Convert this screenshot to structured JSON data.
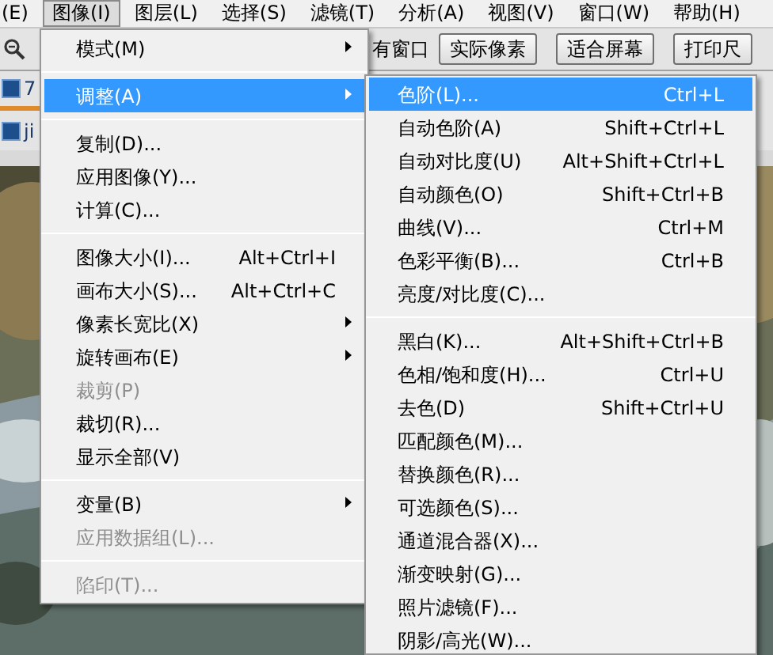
{
  "menubar": [
    {
      "label": "(E)",
      "selected": false
    },
    {
      "label": "图像(I)",
      "selected": true
    },
    {
      "label": "图层(L)",
      "selected": false
    },
    {
      "label": "选择(S)",
      "selected": false
    },
    {
      "label": "滤镜(T)",
      "selected": false
    },
    {
      "label": "分析(A)",
      "selected": false
    },
    {
      "label": "视图(V)",
      "selected": false
    },
    {
      "label": "窗口(W)",
      "selected": false
    },
    {
      "label": "帮助(H)",
      "selected": false
    }
  ],
  "toolbar": {
    "partial_label": "有窗口",
    "buttons": [
      "实际像素",
      "适合屏幕",
      "打印尺"
    ]
  },
  "documents": [
    {
      "label": "7"
    },
    {
      "label": "ji"
    }
  ],
  "image_menu": [
    {
      "kind": "item",
      "label": "模式(M)",
      "submenu": true,
      "selected": false,
      "disabled": false
    },
    {
      "kind": "separator"
    },
    {
      "kind": "item",
      "label": "调整(A)",
      "submenu": true,
      "selected": true,
      "disabled": false
    },
    {
      "kind": "separator"
    },
    {
      "kind": "item",
      "label": "复制(D)...",
      "selected": false,
      "disabled": false
    },
    {
      "kind": "item",
      "label": "应用图像(Y)...",
      "selected": false,
      "disabled": false
    },
    {
      "kind": "item",
      "label": "计算(C)...",
      "selected": false,
      "disabled": false
    },
    {
      "kind": "separator"
    },
    {
      "kind": "item",
      "label": "图像大小(I)...",
      "shortcut": "Alt+Ctrl+I",
      "selected": false,
      "disabled": false
    },
    {
      "kind": "item",
      "label": "画布大小(S)...",
      "shortcut": "Alt+Ctrl+C",
      "selected": false,
      "disabled": false
    },
    {
      "kind": "item",
      "label": "像素长宽比(X)",
      "submenu": true,
      "selected": false,
      "disabled": false
    },
    {
      "kind": "item",
      "label": "旋转画布(E)",
      "submenu": true,
      "selected": false,
      "disabled": false
    },
    {
      "kind": "item",
      "label": "裁剪(P)",
      "selected": false,
      "disabled": true
    },
    {
      "kind": "item",
      "label": "裁切(R)...",
      "selected": false,
      "disabled": false
    },
    {
      "kind": "item",
      "label": "显示全部(V)",
      "selected": false,
      "disabled": false
    },
    {
      "kind": "separator"
    },
    {
      "kind": "item",
      "label": "变量(B)",
      "submenu": true,
      "selected": false,
      "disabled": false
    },
    {
      "kind": "item",
      "label": "应用数据组(L)...",
      "selected": false,
      "disabled": true
    },
    {
      "kind": "separator"
    },
    {
      "kind": "item",
      "label": "陷印(T)...",
      "selected": false,
      "disabled": true
    }
  ],
  "adjust_menu": [
    {
      "kind": "item",
      "label": "色阶(L)...",
      "shortcut": "Ctrl+L",
      "selected": true
    },
    {
      "kind": "item",
      "label": "自动色阶(A)",
      "shortcut": "Shift+Ctrl+L",
      "selected": false
    },
    {
      "kind": "item",
      "label": "自动对比度(U)",
      "shortcut": "Alt+Shift+Ctrl+L",
      "selected": false
    },
    {
      "kind": "item",
      "label": "自动颜色(O)",
      "shortcut": "Shift+Ctrl+B",
      "selected": false
    },
    {
      "kind": "item",
      "label": "曲线(V)...",
      "shortcut": "Ctrl+M",
      "selected": false
    },
    {
      "kind": "item",
      "label": "色彩平衡(B)...",
      "shortcut": "Ctrl+B",
      "selected": false
    },
    {
      "kind": "item",
      "label": "亮度/对比度(C)...",
      "selected": false
    },
    {
      "kind": "separator"
    },
    {
      "kind": "item",
      "label": "黑白(K)...",
      "shortcut": "Alt+Shift+Ctrl+B",
      "selected": false
    },
    {
      "kind": "item",
      "label": "色相/饱和度(H)...",
      "shortcut": "Ctrl+U",
      "selected": false
    },
    {
      "kind": "item",
      "label": "去色(D)",
      "shortcut": "Shift+Ctrl+U",
      "selected": false
    },
    {
      "kind": "item",
      "label": "匹配颜色(M)...",
      "selected": false
    },
    {
      "kind": "item",
      "label": "替换颜色(R)...",
      "selected": false
    },
    {
      "kind": "item",
      "label": "可选颜色(S)...",
      "selected": false
    },
    {
      "kind": "item",
      "label": "通道混合器(X)...",
      "selected": false
    },
    {
      "kind": "item",
      "label": "渐变映射(G)...",
      "selected": false
    },
    {
      "kind": "item",
      "label": "照片滤镜(F)...",
      "selected": false
    },
    {
      "kind": "item",
      "label": "阴影/高光(W)...",
      "selected": false
    }
  ]
}
